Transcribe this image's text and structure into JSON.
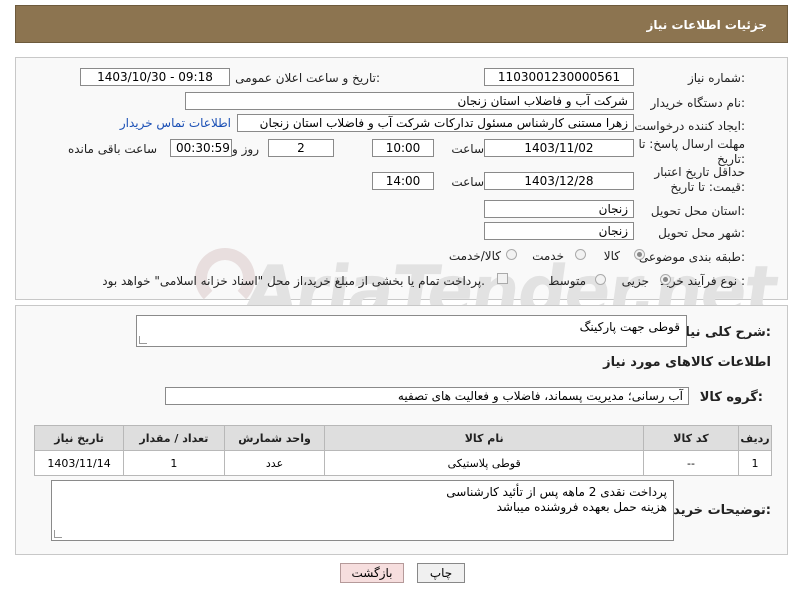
{
  "header": {
    "title": "جزئیات اطلاعات نیاز"
  },
  "watermark": {
    "text": "AriaTender.net"
  },
  "form": {
    "need_number_label": "شماره نیاز:",
    "need_number": "1103001230000561",
    "announce_label": "تاریخ و ساعت اعلان عمومی:",
    "announce_value": "1403/10/30 - 09:18",
    "buyer_org_label": "نام دستگاه خریدار:",
    "buyer_org": "شرکت آب و فاضلاب استان زنجان",
    "creator_label": "ایجاد کننده درخواست:",
    "creator": "زهرا مستنی کارشناس مسئول تدارکات شرکت آب و فاضلاب استان زنجان",
    "contact_link": "اطلاعات تماس خریدار",
    "reply_deadline_label": "مهلت ارسال پاسخ: تا تاریخ:",
    "reply_date": "1403/11/02",
    "time_label": "ساعت",
    "reply_time": "10:00",
    "days_value": "2",
    "days_label": "روز و",
    "remaining_value": "00:30:59",
    "remaining_label": "ساعت باقی مانده",
    "price_validity_label": "حداقل تاریخ اعتبار قیمت: تا تاریخ:",
    "price_date": "1403/12/28",
    "price_time_label": "ساعت",
    "price_time": "14:00",
    "province_label": "استان محل تحویل:",
    "province": "زنجان",
    "city_label": "شهر محل تحویل:",
    "city": "زنجان",
    "category_label": "طبقه بندی موضوعی:",
    "category_options": [
      "کالا",
      "خدمت",
      "کالا/خدمت"
    ],
    "category_selected": "کالا",
    "process_label": "نوع فرآیند خرید :",
    "process_options": [
      "جزیی",
      "متوسط"
    ],
    "process_selected": "جزیی",
    "payment_note": "پرداخت تمام یا بخشی از مبلغ خرید،از محل \"اسناد خزانه اسلامی\" خواهد بود."
  },
  "summary": {
    "label": "شرح کلی نیاز:",
    "value": "قوطی جهت پارکینگ"
  },
  "goods_info": {
    "heading": "اطلاعات کالاهای مورد نیاز",
    "group_label": "گروه کالا:",
    "group_value": "آب رسانی؛ مدیریت پسماند، فاضلاب و فعالیت های تصفیه"
  },
  "table": {
    "headers": [
      "ردیف",
      "کد کالا",
      "نام کالا",
      "واحد شمارش",
      "تعداد / مقدار",
      "تاریخ نیاز"
    ],
    "rows": [
      [
        "1",
        "--",
        "قوطی پلاستیکی",
        "عدد",
        "1",
        "1403/11/14"
      ]
    ]
  },
  "buyer_notes": {
    "label": "توضیحات خریدار:",
    "line1": "پرداخت نقدی 2 ماهه پس از تأئید کارشناسی",
    "line2": "هزینه حمل بعهده فروشنده میباشد"
  },
  "buttons": {
    "print": "چاپ",
    "back": "بازگشت"
  }
}
